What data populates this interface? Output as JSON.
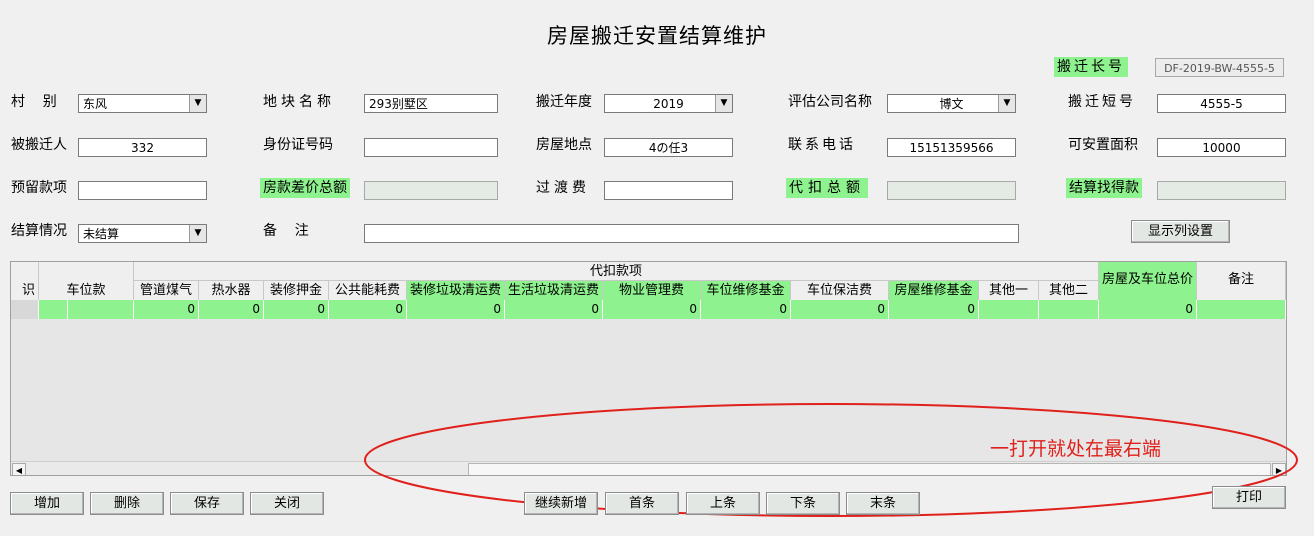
{
  "title": "房屋搬迁安置结算维护",
  "long_no": {
    "label": "搬迁长号",
    "value": "DF-2019-BW-4555-5"
  },
  "form": {
    "village_label": "村    别",
    "village_value": "东风",
    "plot_label": "地块名称",
    "plot_value": "293别墅区",
    "year_label": "搬迁年度",
    "year_value": "2019",
    "appraiser_label": "评估公司名称",
    "appraiser_value": "博文",
    "short_no_label": "搬迁短号",
    "short_no_value": "4555-5",
    "relocatee_label": "被搬迁人",
    "relocatee_value": "332",
    "idcard_label": "身份证号码",
    "idcard_value": "",
    "location_label": "房屋地点",
    "location_value": "4の任3",
    "phone_label": "联系电话",
    "phone_value": "15151359566",
    "area_label": "可安置面积",
    "area_value": "10000",
    "reserved_label": "预留款项",
    "reserved_value": "",
    "diff_label": "房款差价总额",
    "diff_value": "",
    "transition_label": "过渡费",
    "transition_value": "",
    "deduct_label": "代扣总额",
    "deduct_value": "",
    "settle_amount_label": "结算找得款",
    "settle_amount_value": "",
    "status_label": "结算情况",
    "status_value": "未结算",
    "remarks_label": "备    注",
    "remarks_value": ""
  },
  "column_settings_button": "显示列设置",
  "grid": {
    "group_header": "代扣款项",
    "first_col_top": "[",
    "columns": [
      "识",
      "车位款",
      "管道煤气",
      "热水器",
      "装修押金",
      "公共能耗费",
      "装修垃圾清运费",
      "生活垃圾清运费",
      "物业管理费",
      "车位维修基金",
      "车位保洁费",
      "房屋维修基金",
      "其他一",
      "其他二",
      "房屋及车位总价",
      "备注"
    ],
    "row": [
      "",
      "",
      "0",
      "0",
      "0",
      "0",
      "0",
      "0",
      "0",
      "0",
      "0",
      "0",
      "",
      "",
      "0",
      ""
    ]
  },
  "scroll_left": "◀",
  "scroll_right": "▶",
  "annotation": "一打开就处在最右端",
  "buttons": {
    "add": "增加",
    "delete": "删除",
    "save": "保存",
    "close": "关闭",
    "continue_add": "继续新增",
    "first": "首条",
    "prev": "上条",
    "next": "下条",
    "last": "末条",
    "print": "打印"
  },
  "colors": {
    "highlight": "#8ef28e",
    "annotation": "#e0201b"
  }
}
